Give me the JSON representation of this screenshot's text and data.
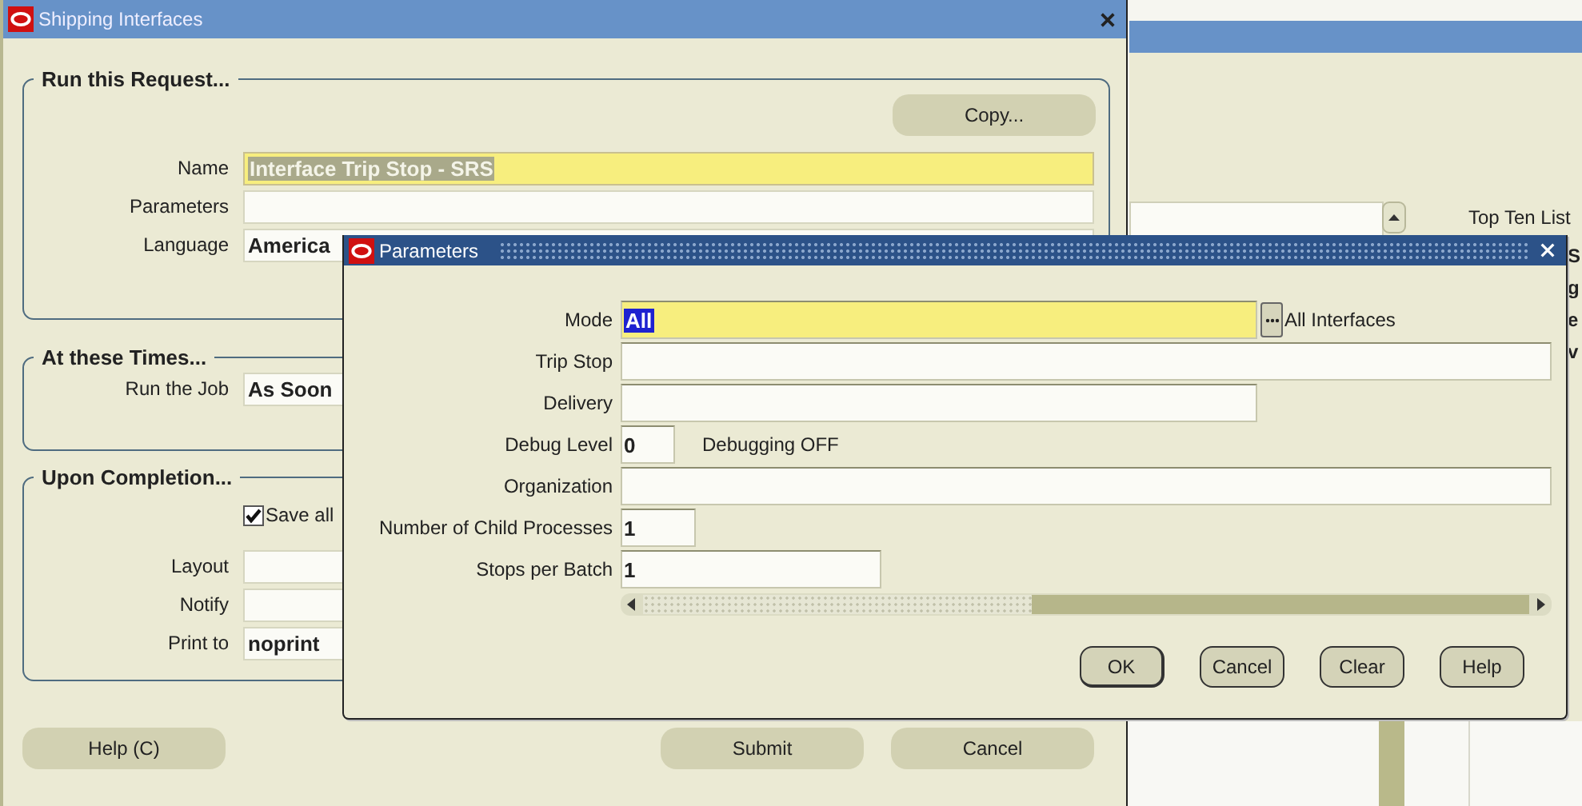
{
  "main_window": {
    "title": "Shipping Interfaces",
    "run_request": {
      "title": "Run this Request...",
      "copy_button": "Copy...",
      "fields": [
        {
          "label": "Name",
          "value": "Interface Trip Stop - SRS",
          "required": true,
          "selected": true
        },
        {
          "label": "Parameters",
          "required": false
        },
        {
          "label": "Language",
          "value": "America",
          "required": false,
          "selected": false
        }
      ]
    },
    "schedule": {
      "title": "At these Times...",
      "fields": [
        {
          "label": "Run the Job",
          "value": "As Soon",
          "required": false,
          "selected": false
        }
      ]
    },
    "completion": {
      "title": "Upon Completion...",
      "save_checkbox": {
        "label": "Save all",
        "checked": true
      },
      "fields": [
        {
          "label": "Layout",
          "required": false
        },
        {
          "label": "Notify",
          "required": false
        },
        {
          "label": "Print to",
          "value": "noprint",
          "required": false,
          "selected": false
        }
      ]
    },
    "buttons": [
      "Help (C)",
      "Submit",
      "Cancel"
    ]
  },
  "background_window": {
    "list_label": "Top Ten List",
    "fragments": [
      "S",
      "g",
      "e",
      "v"
    ]
  },
  "parameters_dialog": {
    "title": "Parameters",
    "fields": [
      {
        "label": "Mode",
        "value": "All",
        "required": true,
        "selected": true,
        "lov": true,
        "description": "All Interfaces"
      },
      {
        "label": "Trip Stop",
        "required": false
      },
      {
        "label": "Delivery",
        "required": false
      },
      {
        "label": "Debug Level",
        "value": "0",
        "required": false,
        "selected": false,
        "description": "Debugging OFF"
      },
      {
        "label": "Organization",
        "required": false
      },
      {
        "label": "Number of Child Processes",
        "value": "1",
        "required": false,
        "selected": false
      },
      {
        "label": "Stops per Batch",
        "value": "1",
        "required": false,
        "selected": false
      }
    ],
    "buttons": [
      {
        "label": "OK",
        "default": true
      },
      {
        "label": "Cancel",
        "default": false
      },
      {
        "label": "Clear",
        "default": false
      },
      {
        "label": "Help",
        "default": false
      }
    ]
  }
}
